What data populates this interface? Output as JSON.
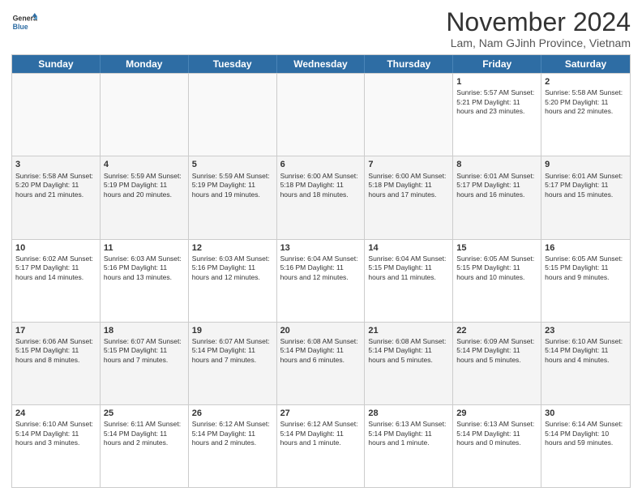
{
  "logo": {
    "line1": "General",
    "line2": "Blue"
  },
  "title": "November 2024",
  "location": "Lam, Nam GJinh Province, Vietnam",
  "days_of_week": [
    "Sunday",
    "Monday",
    "Tuesday",
    "Wednesday",
    "Thursday",
    "Friday",
    "Saturday"
  ],
  "rows": [
    [
      {
        "day": "",
        "info": "",
        "empty": true
      },
      {
        "day": "",
        "info": "",
        "empty": true
      },
      {
        "day": "",
        "info": "",
        "empty": true
      },
      {
        "day": "",
        "info": "",
        "empty": true
      },
      {
        "day": "",
        "info": "",
        "empty": true
      },
      {
        "day": "1",
        "info": "Sunrise: 5:57 AM\nSunset: 5:21 PM\nDaylight: 11 hours\nand 23 minutes.",
        "empty": false
      },
      {
        "day": "2",
        "info": "Sunrise: 5:58 AM\nSunset: 5:20 PM\nDaylight: 11 hours\nand 22 minutes.",
        "empty": false
      }
    ],
    [
      {
        "day": "3",
        "info": "Sunrise: 5:58 AM\nSunset: 5:20 PM\nDaylight: 11 hours\nand 21 minutes.",
        "empty": false
      },
      {
        "day": "4",
        "info": "Sunrise: 5:59 AM\nSunset: 5:19 PM\nDaylight: 11 hours\nand 20 minutes.",
        "empty": false
      },
      {
        "day": "5",
        "info": "Sunrise: 5:59 AM\nSunset: 5:19 PM\nDaylight: 11 hours\nand 19 minutes.",
        "empty": false
      },
      {
        "day": "6",
        "info": "Sunrise: 6:00 AM\nSunset: 5:18 PM\nDaylight: 11 hours\nand 18 minutes.",
        "empty": false
      },
      {
        "day": "7",
        "info": "Sunrise: 6:00 AM\nSunset: 5:18 PM\nDaylight: 11 hours\nand 17 minutes.",
        "empty": false
      },
      {
        "day": "8",
        "info": "Sunrise: 6:01 AM\nSunset: 5:17 PM\nDaylight: 11 hours\nand 16 minutes.",
        "empty": false
      },
      {
        "day": "9",
        "info": "Sunrise: 6:01 AM\nSunset: 5:17 PM\nDaylight: 11 hours\nand 15 minutes.",
        "empty": false
      }
    ],
    [
      {
        "day": "10",
        "info": "Sunrise: 6:02 AM\nSunset: 5:17 PM\nDaylight: 11 hours\nand 14 minutes.",
        "empty": false
      },
      {
        "day": "11",
        "info": "Sunrise: 6:03 AM\nSunset: 5:16 PM\nDaylight: 11 hours\nand 13 minutes.",
        "empty": false
      },
      {
        "day": "12",
        "info": "Sunrise: 6:03 AM\nSunset: 5:16 PM\nDaylight: 11 hours\nand 12 minutes.",
        "empty": false
      },
      {
        "day": "13",
        "info": "Sunrise: 6:04 AM\nSunset: 5:16 PM\nDaylight: 11 hours\nand 12 minutes.",
        "empty": false
      },
      {
        "day": "14",
        "info": "Sunrise: 6:04 AM\nSunset: 5:15 PM\nDaylight: 11 hours\nand 11 minutes.",
        "empty": false
      },
      {
        "day": "15",
        "info": "Sunrise: 6:05 AM\nSunset: 5:15 PM\nDaylight: 11 hours\nand 10 minutes.",
        "empty": false
      },
      {
        "day": "16",
        "info": "Sunrise: 6:05 AM\nSunset: 5:15 PM\nDaylight: 11 hours\nand 9 minutes.",
        "empty": false
      }
    ],
    [
      {
        "day": "17",
        "info": "Sunrise: 6:06 AM\nSunset: 5:15 PM\nDaylight: 11 hours\nand 8 minutes.",
        "empty": false
      },
      {
        "day": "18",
        "info": "Sunrise: 6:07 AM\nSunset: 5:15 PM\nDaylight: 11 hours\nand 7 minutes.",
        "empty": false
      },
      {
        "day": "19",
        "info": "Sunrise: 6:07 AM\nSunset: 5:14 PM\nDaylight: 11 hours\nand 7 minutes.",
        "empty": false
      },
      {
        "day": "20",
        "info": "Sunrise: 6:08 AM\nSunset: 5:14 PM\nDaylight: 11 hours\nand 6 minutes.",
        "empty": false
      },
      {
        "day": "21",
        "info": "Sunrise: 6:08 AM\nSunset: 5:14 PM\nDaylight: 11 hours\nand 5 minutes.",
        "empty": false
      },
      {
        "day": "22",
        "info": "Sunrise: 6:09 AM\nSunset: 5:14 PM\nDaylight: 11 hours\nand 5 minutes.",
        "empty": false
      },
      {
        "day": "23",
        "info": "Sunrise: 6:10 AM\nSunset: 5:14 PM\nDaylight: 11 hours\nand 4 minutes.",
        "empty": false
      }
    ],
    [
      {
        "day": "24",
        "info": "Sunrise: 6:10 AM\nSunset: 5:14 PM\nDaylight: 11 hours\nand 3 minutes.",
        "empty": false
      },
      {
        "day": "25",
        "info": "Sunrise: 6:11 AM\nSunset: 5:14 PM\nDaylight: 11 hours\nand 2 minutes.",
        "empty": false
      },
      {
        "day": "26",
        "info": "Sunrise: 6:12 AM\nSunset: 5:14 PM\nDaylight: 11 hours\nand 2 minutes.",
        "empty": false
      },
      {
        "day": "27",
        "info": "Sunrise: 6:12 AM\nSunset: 5:14 PM\nDaylight: 11 hours\nand 1 minute.",
        "empty": false
      },
      {
        "day": "28",
        "info": "Sunrise: 6:13 AM\nSunset: 5:14 PM\nDaylight: 11 hours\nand 1 minute.",
        "empty": false
      },
      {
        "day": "29",
        "info": "Sunrise: 6:13 AM\nSunset: 5:14 PM\nDaylight: 11 hours\nand 0 minutes.",
        "empty": false
      },
      {
        "day": "30",
        "info": "Sunrise: 6:14 AM\nSunset: 5:14 PM\nDaylight: 10 hours\nand 59 minutes.",
        "empty": false
      }
    ]
  ]
}
